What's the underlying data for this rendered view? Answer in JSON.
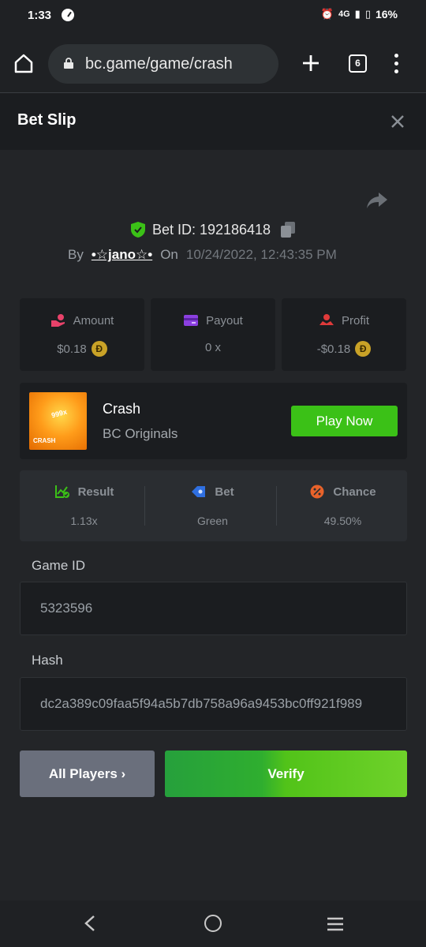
{
  "status_bar": {
    "time": "1:33",
    "network": "4G",
    "battery": "16%"
  },
  "browser": {
    "url": "bc.game/game/crash",
    "tab_count": "6"
  },
  "modal": {
    "title": "Bet Slip"
  },
  "bet": {
    "id_label": "Bet ID: 192186418",
    "by_label": "By",
    "user": "•☆jano☆•",
    "on_label": "On",
    "date": "10/24/2022, 12:43:35 PM"
  },
  "stats": {
    "amount": {
      "label": "Amount",
      "value": "$0.18"
    },
    "payout": {
      "label": "Payout",
      "value": "0 x"
    },
    "profit": {
      "label": "Profit",
      "value": "-$0.18"
    },
    "coin_symbol": "Ð"
  },
  "game": {
    "name": "Crash",
    "provider": "BC Originals",
    "play_label": "Play Now",
    "thumb_badge": "999x",
    "thumb_label": "CRASH"
  },
  "result": {
    "result": {
      "label": "Result",
      "value": "1.13x"
    },
    "bet": {
      "label": "Bet",
      "value": "Green"
    },
    "chance": {
      "label": "Chance",
      "value": "49.50%"
    }
  },
  "fields": {
    "game_id": {
      "label": "Game ID",
      "value": "5323596"
    },
    "hash": {
      "label": "Hash",
      "value": "dc2a389c09faa5f94a5b7db758a96a9453bc0ff921f989"
    }
  },
  "actions": {
    "all_players": "All Players ›",
    "verify": "Verify"
  },
  "colors": {
    "accent_green": "#3bc117",
    "shield_green": "#3bc117",
    "coin": "#c9a227"
  }
}
